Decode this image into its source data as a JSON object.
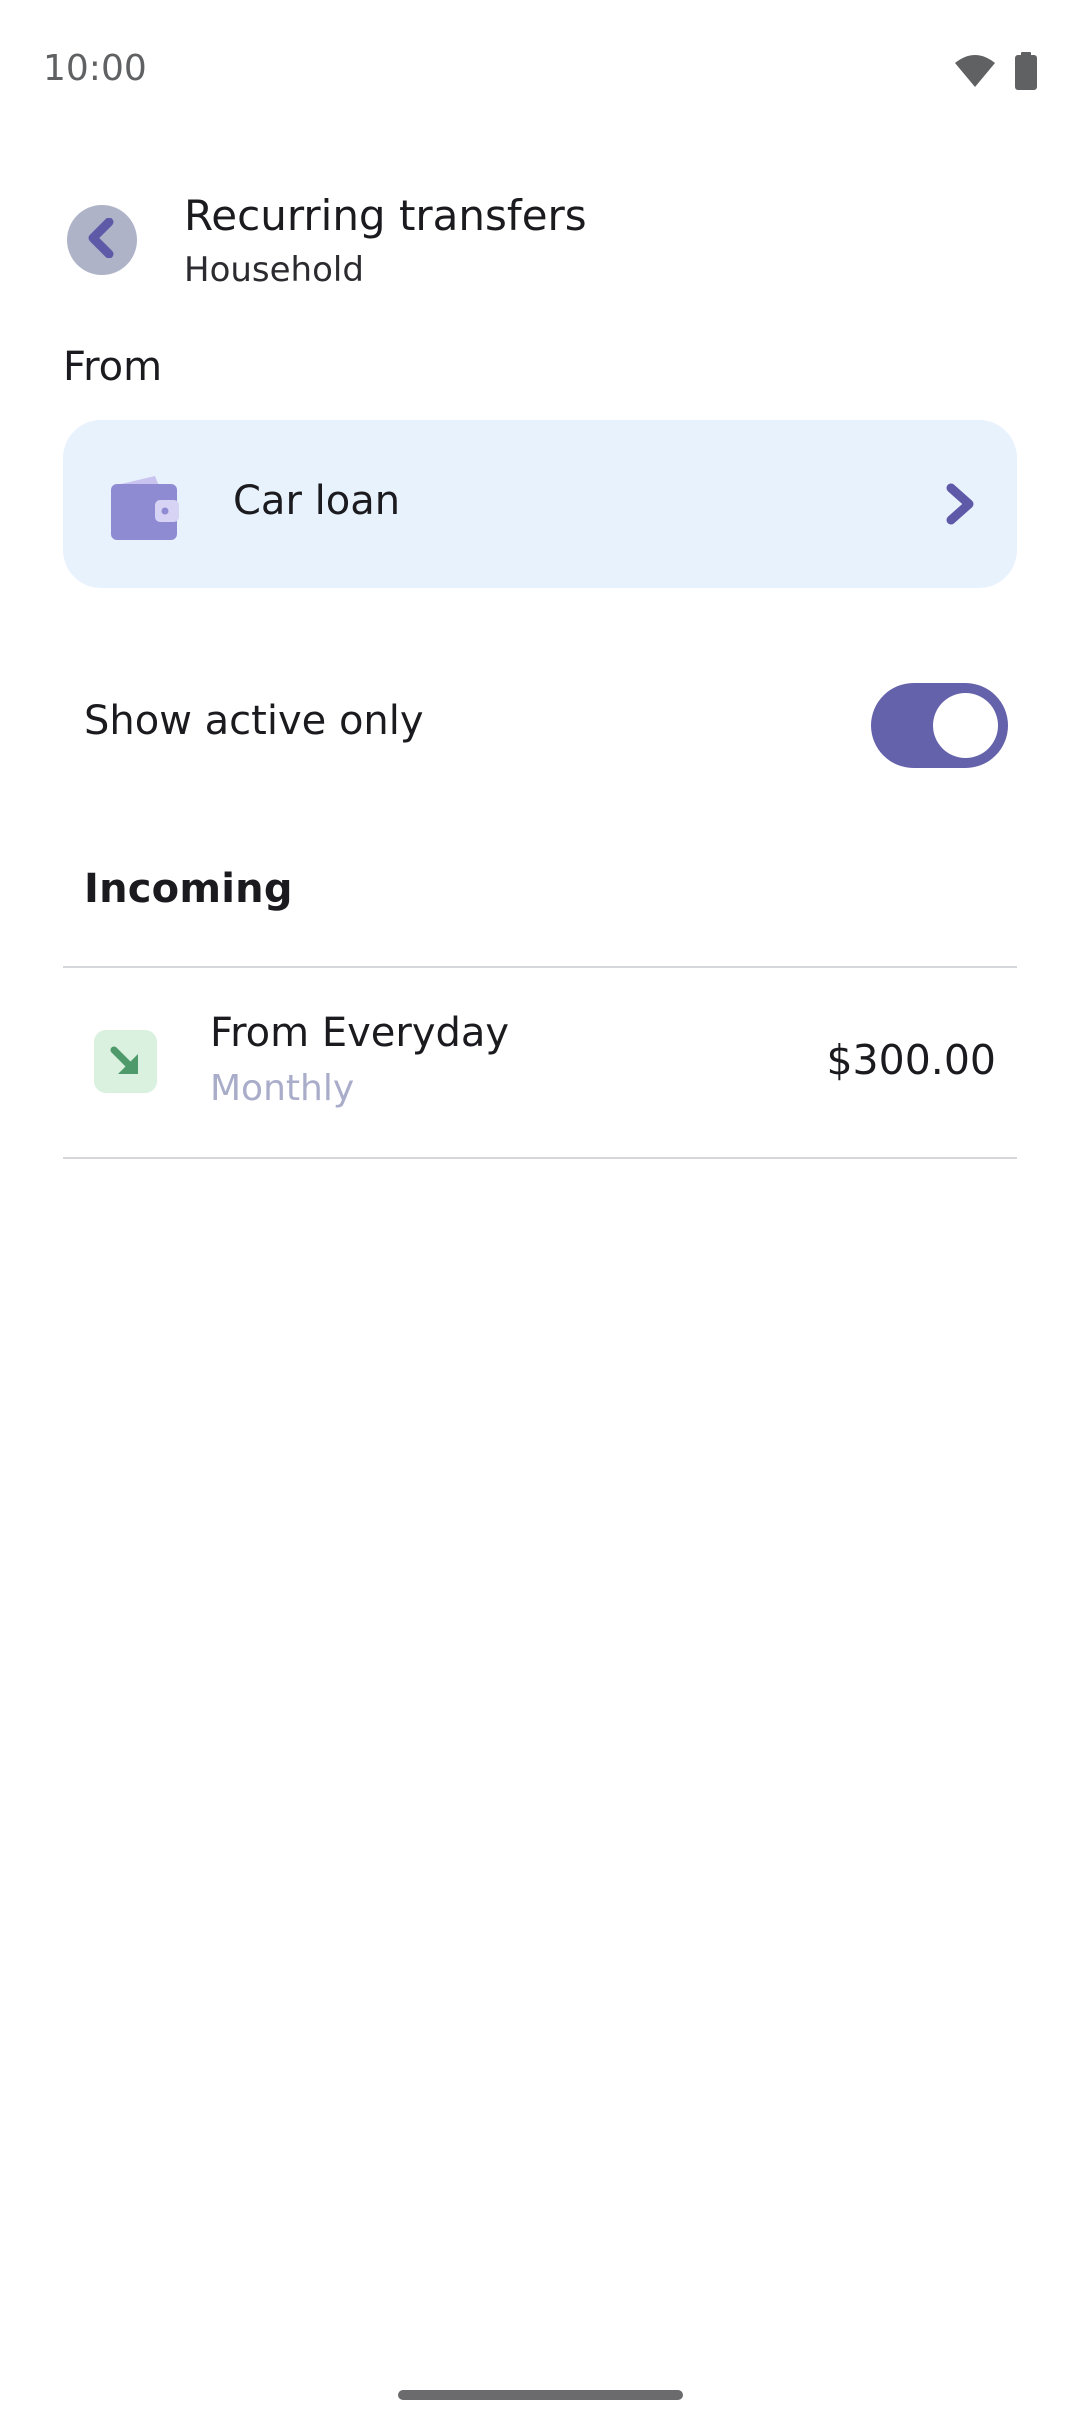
{
  "status_bar": {
    "time": "10:00",
    "icons": [
      "wifi-icon",
      "battery-icon"
    ]
  },
  "header": {
    "back_icon": "chevron-left-icon",
    "title": "Recurring transfers",
    "subtitle": "Household"
  },
  "from": {
    "label": "From",
    "account": {
      "icon": "wallet-icon",
      "name": "Car loan",
      "chevron": "chevron-right-icon"
    }
  },
  "filter": {
    "label": "Show active only",
    "enabled": true
  },
  "incoming": {
    "title": "Incoming",
    "items": [
      {
        "icon": "arrow-down-right-icon",
        "title": "From Everyday",
        "frequency": "Monthly",
        "amount": "$300.00"
      }
    ]
  },
  "colors": {
    "accent": "#6562ac",
    "selector_bg": "#e8f2fd",
    "back_button_bg": "#aeb3c8",
    "incoming_icon_bg": "#d9f1de",
    "incoming_icon_fg": "#4f9a6a",
    "muted_text": "#a9adc9"
  }
}
